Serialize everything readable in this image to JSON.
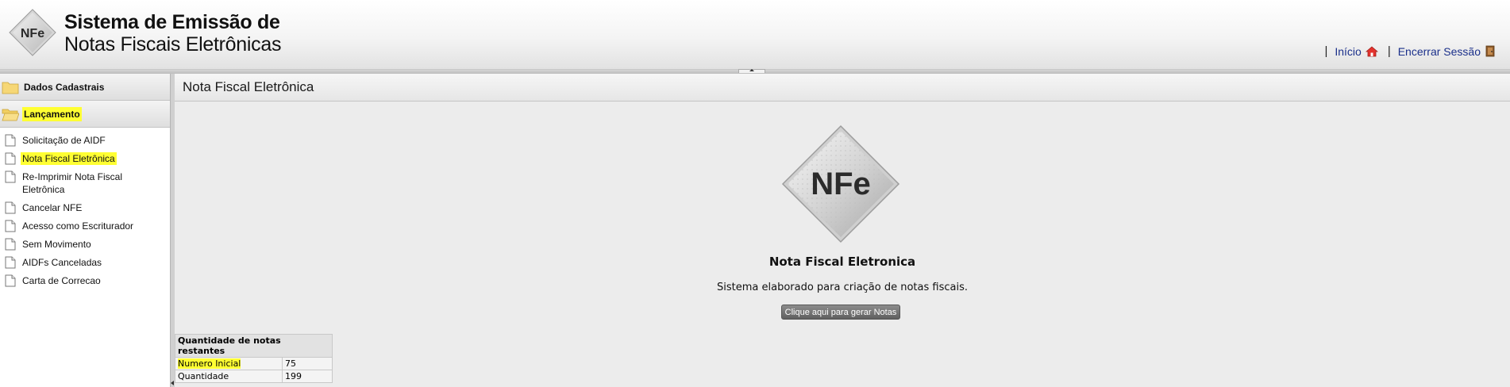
{
  "header": {
    "title_line1": "Sistema de Emissão de",
    "title_line2": "Notas Fiscais Eletrônicas",
    "logo_text": "NFe",
    "nav": [
      {
        "label": "Início",
        "icon": "home-icon"
      },
      {
        "label": "Encerrar Sessão",
        "icon": "exit-door-icon"
      }
    ]
  },
  "sidebar": {
    "folders": [
      {
        "label": "Dados Cadastrais",
        "icon": "folder-icon"
      },
      {
        "label": "Lançamento",
        "icon": "folder-open-icon",
        "highlighted": true
      }
    ],
    "items": [
      {
        "label": "Solicitação de AIDF"
      },
      {
        "label": "Nota Fiscal Eletrônica",
        "highlighted": true
      },
      {
        "label": "Re-Imprimir Nota Fiscal Eletrônica"
      },
      {
        "label": "Cancelar NFE"
      },
      {
        "label": "Acesso como Escriturador"
      },
      {
        "label": "Sem Movimento"
      },
      {
        "label": "AIDFs Canceladas"
      },
      {
        "label": "Carta de Correcao"
      }
    ]
  },
  "main": {
    "title": "Nota Fiscal Eletrônica",
    "logo_text": "NFe",
    "heading": "Nota Fiscal Eletronica",
    "subtitle": "Sistema elaborado para criação de notas fiscais.",
    "button_label": "Clique aqui para gerar Notas"
  },
  "count_table": {
    "header": "Quantidade de notas restantes",
    "rows": [
      {
        "label": "Numero Inicial",
        "value": "75",
        "highlighted": true
      },
      {
        "label": "Quantidade",
        "value": "199"
      }
    ]
  },
  "colors": {
    "highlight": "#ffff33",
    "link": "#1a2f8a"
  }
}
